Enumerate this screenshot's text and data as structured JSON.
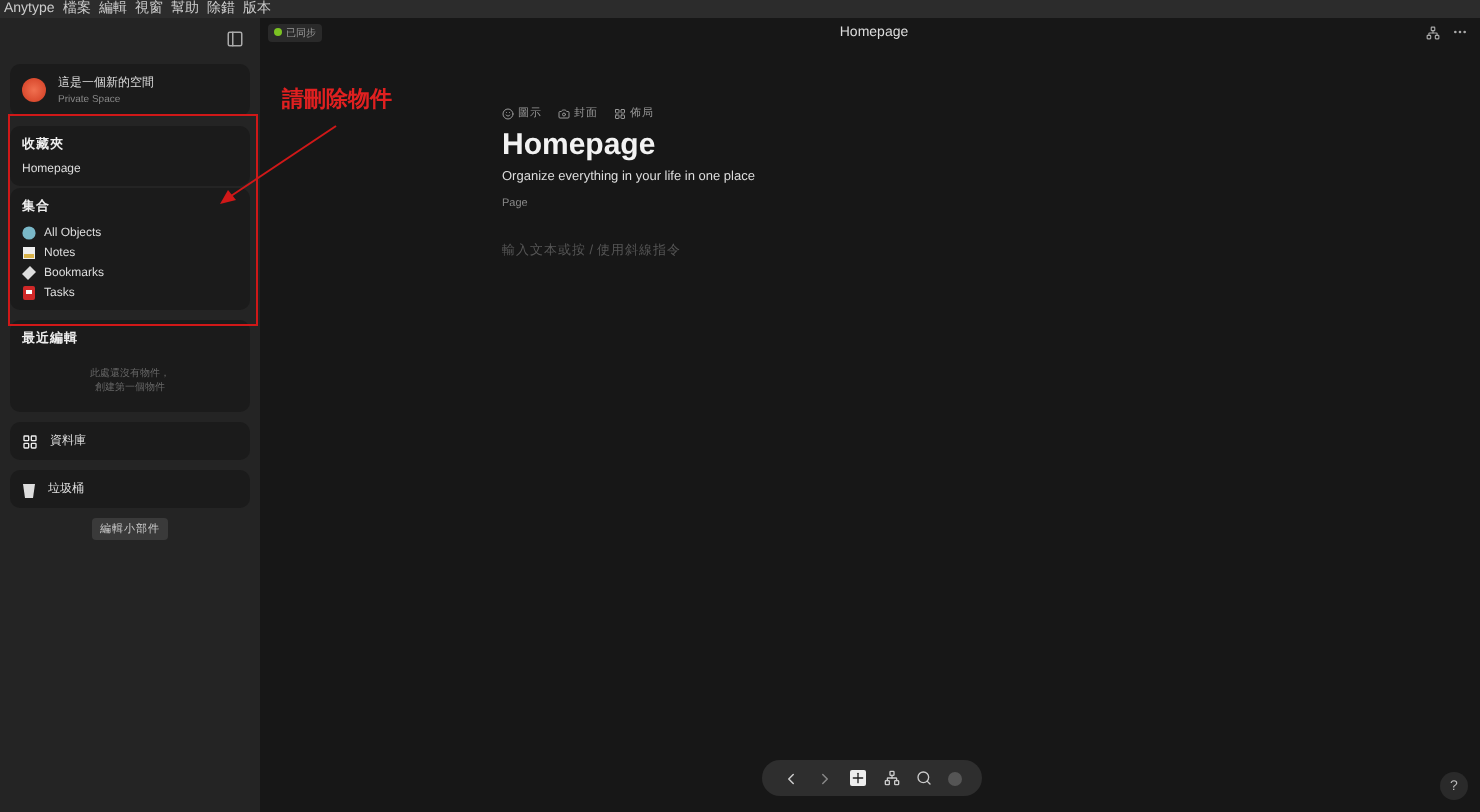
{
  "menu_bar": [
    "Anytype",
    "檔案",
    "編輯",
    "視窗",
    "幫助",
    "除錯",
    "版本"
  ],
  "sync_status": {
    "label": "已同步",
    "synced": true
  },
  "window": {
    "title": "Homepage"
  },
  "space": {
    "name": "這是一個新的空間",
    "type": "Private Space"
  },
  "favorites": {
    "title": "收藏夾",
    "items": [
      "Homepage"
    ]
  },
  "collections": {
    "title": "集合",
    "items": [
      {
        "label": "All Objects",
        "kind": "globe"
      },
      {
        "label": "Notes",
        "kind": "note"
      },
      {
        "label": "Bookmarks",
        "kind": "bookmark"
      },
      {
        "label": "Tasks",
        "kind": "task"
      }
    ]
  },
  "recent": {
    "title": "最近編輯",
    "empty_lines": [
      "此處還沒有物件，",
      "創建第一個物件"
    ]
  },
  "library": {
    "label": "資料庫"
  },
  "bin": {
    "label": "垃圾桶"
  },
  "edit_widgets": "編輯小部件",
  "annotation": "請刪除物件",
  "page": {
    "actions": [
      {
        "label": "圖示",
        "kind": "smile"
      },
      {
        "label": "封面",
        "kind": "camera"
      },
      {
        "label": "佈局",
        "kind": "layout"
      }
    ],
    "title": "Homepage",
    "description": "Organize everything in your life in one place",
    "type": "Page",
    "placeholder": "輸入文本或按 / 使用斜線指令"
  },
  "help": "?"
}
